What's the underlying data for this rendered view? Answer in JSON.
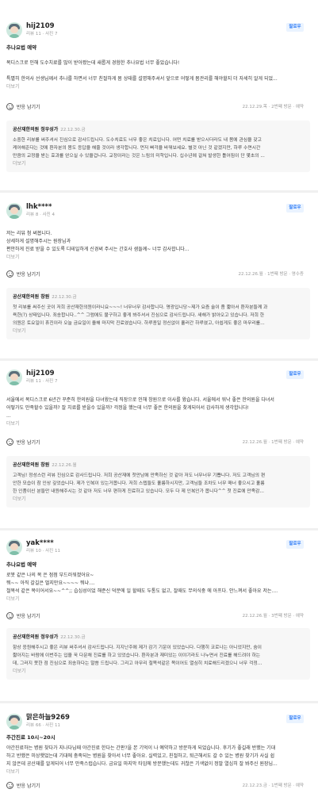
{
  "reviews": [
    {
      "author": "hij2109",
      "stats": "리뷰 11 · 사진 7",
      "follow": "팔로우",
      "visit_title": "추나요법 예약",
      "lines": [
        "목디스크로 인해 도수치료를 많이 받아봤는데 새롭게 경험한 추나요법 너무 좋았습니다!",
        "",
        "특별히 한의사 선생님께서 추나를 하면서 너무 친절하게 몸 상태를 설명해주셔서 앞으로 어떻게 몸관리를 해야할지 더 자세히 알게 되었..."
      ],
      "more": "더보기",
      "react": "반응 남기기",
      "visit_info": "22.12.29.목 · 2번째 방문 · 예약",
      "reply": {
        "owner": "공산재한의원 정우성가",
        "date": "22.12.30.금",
        "lines": [
          "소중한 리뷰를 써주셔서 진심으로 감사드립니다. 도수치료도 너무 좋은 치료입니다. 어떤 치료를 받으시더라도 내 몸에 관심을 갖고",
          "케어해준다는 것에 환자분의 몸도 응답을 해줄 것이라 생각합니다. 먼저 삐걱을 바꿔보세요. 별것 아닌 것 같겠지만, 하루 수면시간",
          "만큼의 교정을 받는 효과를 얻으실 수 있을겁니다. 교정이라는 것은 느림의 미학입니다. 십수년에 걸쳐 발생한 틀어짐이 단 몇초의 ..."
        ],
        "more": "더보기"
      }
    },
    {
      "author": "lhk****",
      "stats": "리뷰 8 · 사진 4",
      "follow": "팔로우",
      "visit_title": "",
      "lines": [
        "저는 리뷰 첨 써봅니다.",
        "상세하게 설명해주시는 원장님과",
        "편안하게 진료 받을 수 있도록 디테일하게 신경써 주시는 간호사 샘들께~ 너무 감사합니다..."
      ],
      "more": "더보기",
      "react": "반응 남기기",
      "visit_info": "22.12.26.월 · 1번째 방문 · 영수증",
      "reply": {
        "owner": "공산재한의원 창원",
        "date": "22.12.30.금",
        "lines": [
          "첫 리뷰를 써주신 곳이 저희 공산재한의원이라니요~~~! 너무너무 감사합니다. 명광입니당~제가 요즘 술이 좀 짧아서 환자분들께 과",
          "욕한(?) 상태입니다. 죄송합니다..^^ 그럼에도 불구하고 좋게 봐주셔서 진심으로 감사드립니다. 새해가 밝아오고 있습니다. 저희 한",
          "의원은 토요일이 휴진이라 오늘 금요일이 올해 마지막 진료였습니다. 하루종일 정신없이 흘러간 하루였고, 아쉽게도 좋은 마무리를..."
        ],
        "more": "더보기"
      }
    },
    {
      "author": "hij2109",
      "stats": "리뷰 11 · 사진 7",
      "follow": "팔로우",
      "visit_title": "",
      "lines": [
        "서울에서 목디스크로 6년간 꾸준히 한의원을 다녀왔는데 직장으로 인해 창원으로 이사를 왔습니다. 서울에서 워낙 좋은 한의원을 다녀서",
        "어떻가도 만족할수 있을까? 잘 치료를 받을수 있을까? 걱정을 했는데 너무 좋은 한의원을 찾게되어서 감사하게 생각합니다!",
        "..."
      ],
      "more": "더보기",
      "react": "반응 남기기",
      "visit_info": "22.12.26.월 · 1번째 방문 · 예약",
      "reply": {
        "owner": "공산재한의원 창원",
        "date": "22.12.26.월",
        "lines": [
          "고객님! 정성스런 리뷰 진심으로 감사드립니다. 저희 공산재에 첫만남에 만족하신 것 같아 저도 너무너무 기쁩니다. 저도 고객님의 편",
          "안한 모습이 참 인상 깊었습니다. 제가 인복이 있는거봅니다. 저희 스텝들도 훌륭하시지만, 고객님들 조차도 너무 매너 좋으시고 훌륭",
          "한 인품이신 분들만 내원해주시는 것 같아 저도 너무 편하게 진료하고 있습니다. 모두 다 제 인복인가 봅니다^^ 첫 진료에 만족감..."
        ],
        "more": "더보기"
      }
    },
    {
      "author": "yak****",
      "stats": "리뷰 10 · 사진 11",
      "follow": "팔로우",
      "visit_title": "추나요법 예약",
      "lines": [
        "로봇 같은 나의 목 은 점점 부드러워졌어요~",
        "뭐~~ 아직 갈길은 멀지만요~~~~ 뭐냐....",
        "철목석 같은 목이어서요~~^^;; 습심성이었 해준신 덕분에 일 할때도 두통도 없고, 잘때도 무의식중 에 아프다. 안느껴서 좋아요 저는...."
      ],
      "more": "더보기",
      "react": "반응 남기기",
      "visit_info": "22.12.26.월 · 3번째 방문 · 예약",
      "reply": {
        "owner": "공산재한의원 정우성가",
        "date": "22.12.30.금",
        "lines": [
          "항상 응원해주시고 좋은 리뷰 써주셔서 감사드립니다. 지지난주에 제가 감기 기운이 있었습니다. 다행히 코로나는 아니었지만, 숨이",
          "짧아지는 바람에 이번주는 입을 꾹 다문채 진료를 하고 있었습니다. 환자분과 재미있는 이야기라도 나누면서 진료를 해드려야 하는",
          "데, 그러지 못한 점 진심으로 죄송하다는 말씀 드립니다. 그리고 아무리 철목석같은 목이어도 열심히 치료해드리겠으니 너무 걱정..."
        ],
        "more": "더보기"
      }
    },
    {
      "author": "맑은하늘9269",
      "stats": "리뷰 66 · 사진 11",
      "follow": "팔로우",
      "visit_title": "주간진료 10시~20시",
      "lines": [
        "야간진료하는 병원 찾다가 지나다님때 야간진료 한다는 간판?을 본 기억이 나 예약하고 방문하게 되었습니다. 후기가 좋길래 반했는 기대",
        "하고 반했은 미상햇었는데 기대에 충족되는 병원을 찾아서 너무 좋아요. 실력있고, 친절하고, 퇴근해서도 갈 수 있는 병원 찾기가 사실 쉽",
        "지 않은데 공산재를 알게되어 너무 만족스럽습니다. 금요일 마지막 타임에 방문했는데도 귀찮은 기색없이 정말 열심히 잘 봐주신 원장님..."
      ],
      "more": "더보기",
      "react": "반응 남기기",
      "visit_info": "22.12.23.금 · 1번째 방문 · 예약"
    }
  ]
}
